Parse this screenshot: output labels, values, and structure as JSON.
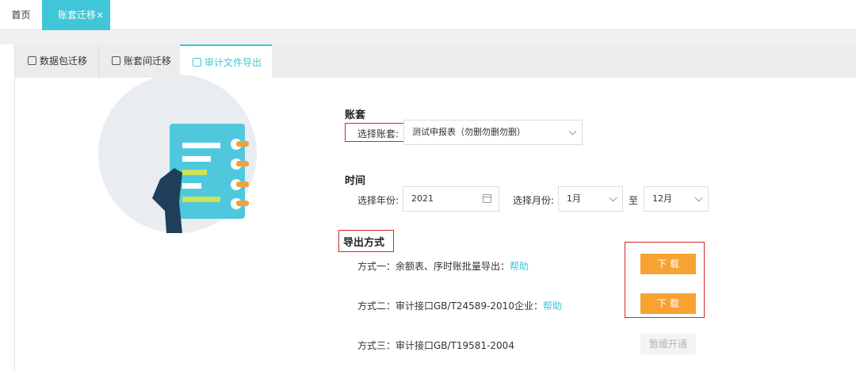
{
  "top_tabs": [
    {
      "label": "首页"
    },
    {
      "label": "账套迁移",
      "close": "×"
    }
  ],
  "sub_tabs": [
    {
      "label": "数据包迁移"
    },
    {
      "label": "账套间迁移"
    },
    {
      "label": "审计文件导出"
    }
  ],
  "account": {
    "title": "账套",
    "label": "选择账套:",
    "value": "测试申报表（勿删勿删勿删）"
  },
  "time": {
    "title": "时间",
    "year_label": "选择年份:",
    "year_value": "2021",
    "month_label": "选择月份:",
    "month_from": "1月",
    "to_label": "至",
    "month_to": "12月"
  },
  "export": {
    "title": "导出方式",
    "methods": [
      {
        "text": "方式一：余额表、序时账批量导出：",
        "help": "帮助",
        "button": "下 载"
      },
      {
        "text": "方式二：审计接口GB/T24589-2010企业：",
        "help": "帮助",
        "button": "下 载"
      },
      {
        "text": "方式三：审计接口GB/T19581-2004",
        "button": "暂缓开通"
      }
    ]
  },
  "colors": {
    "accent": "#3fc6d8",
    "download": "#f7a233",
    "highlight": "#d9262c"
  }
}
